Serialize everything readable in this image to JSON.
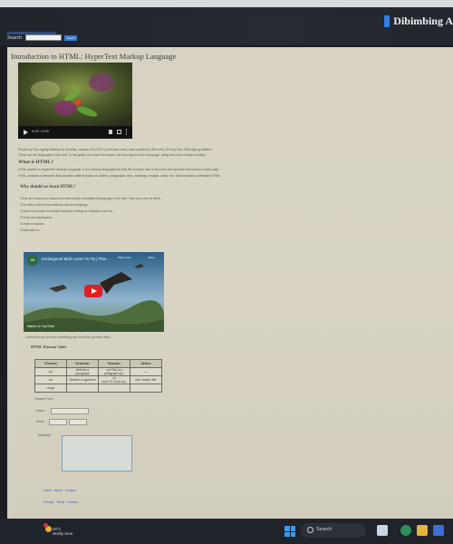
{
  "site": {
    "brand": "Dibimbing A",
    "search_label": "Search:",
    "search_placeholder": "",
    "search_button": "Search"
  },
  "page": {
    "title": "Introduction to HTML: HyperText Markup Language",
    "video_time": "0:00 / 0:00",
    "para1": "Posted by Pipo Agung Adiatmo on Monday, January 21st 2025 | 6 minutes read | Last updated by Wee edit | 30 Aug 21st, 2025 Agung Adiatmo",
    "para2": "These are the languages of the web. In this guide, let's learn the basics, the core layout of the web page, using text that is simple to follow.",
    "what_heading": "What is HTML?",
    "para3": "HTML stands for HyperText Markup Language. It is a markup language that tells the browser how to structure and describe the content of web page.",
    "para4": "HTML consists of elements that describe different types of content: paragraphs, links, headings, images, video, etc. Web browsers understand HTML.",
    "why_heading": "Why should we learn HTML?",
    "list_intro": "There are numerous reasons for learning the foundational language of the web. Here are a few of them:",
    "list": [
      "To be able to use the foundational web dev language",
      "To learn and create the website structure of things on websites in the list",
      "To build web applications",
      "To improve layouts",
      "Collaboration"
    ],
    "video_note": "Lorem like you find out something new from this youtube video",
    "table_heading": "HTML Element Table",
    "form_heading": "Contact Form",
    "form_labels": [
      "Name",
      "Email",
      "Message"
    ]
  },
  "youtube": {
    "channel": "DB",
    "title": "Endangered Birds Learn To Fly | Plan...",
    "watch_later": "Watch later",
    "share": "Share",
    "watch_on": "Watch on YouTube"
  },
  "table": {
    "headers": [
      "Element",
      "Deskripsi",
      "Example",
      "Atribut"
    ],
    "rows": [
      [
        "<p>",
        "Defines a paragraph",
        "<p>This is a paragraph</p>",
        "—"
      ],
      [
        "<a>",
        "Defines a hyperlink",
        "<a href=\"#\">Link</a>",
        "href, target, title"
      ],
      [
        "<img>",
        "",
        "",
        ""
      ]
    ]
  },
  "footer_links": [
    "Home",
    "About",
    "Contact",
    "Privacy",
    "Terms",
    "Careers"
  ],
  "taskbar": {
    "weather_temp": "28°C",
    "weather_desc": "Mostly clear",
    "search": "Search"
  },
  "colors": {
    "page_bg": "#d7d2c2",
    "header_bg": "#22262d",
    "accent": "#2f7ee0",
    "link": "#3a63b6"
  }
}
